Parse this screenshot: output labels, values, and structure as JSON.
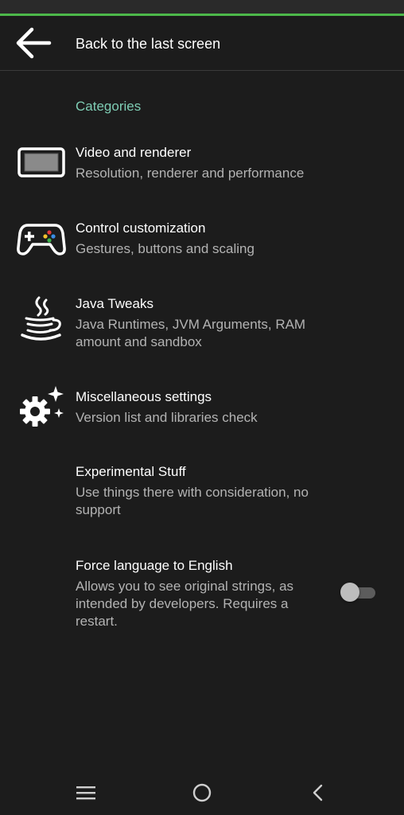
{
  "appbar": {
    "title": "Back to the last screen",
    "back_icon": "arrow-back-icon"
  },
  "category": {
    "header": "Categories"
  },
  "preferences": [
    {
      "title": "Video and renderer",
      "summary": "Resolution, renderer and performance",
      "icon": "display-icon"
    },
    {
      "title": "Control customization",
      "summary": "Gestures, buttons and scaling",
      "icon": "gamepad-icon"
    },
    {
      "title": "Java Tweaks",
      "summary": "Java Runtimes, JVM Arguments, RAM amount and sandbox",
      "icon": "java-cup-icon"
    },
    {
      "title": "Miscellaneous settings",
      "summary": "Version list and libraries check",
      "icon": "gear-sparkle-icon"
    },
    {
      "title": "Experimental Stuff",
      "summary": "Use things there with consideration, no support"
    },
    {
      "title": "Force language to English",
      "summary": "Allows you to see original strings, as intended by developers. Requires a restart.",
      "toggle_on": false
    }
  ],
  "navbar": {
    "recents_icon": "menu-lines-icon",
    "home_icon": "home-circle-icon",
    "back_icon": "chevron-left-icon"
  },
  "colors": {
    "background": "#1c1c1c",
    "accent_line": "#4cb84a",
    "category_header": "#7ecdb4",
    "summary_text": "#b3b3b3"
  }
}
